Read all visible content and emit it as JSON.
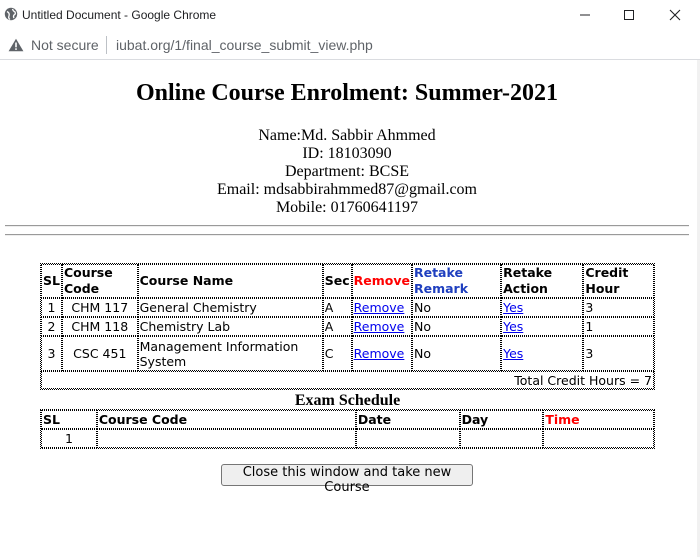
{
  "window": {
    "title": "Untitled Document - Google Chrome",
    "security_label": "Not secure",
    "url": "iubat.org/1/final_course_submit_view.php"
  },
  "page": {
    "heading": "Online Course Enrolment: Summer-2021",
    "student": {
      "name": "Name:Md. Sabbir Ahmmed",
      "id": "ID: 18103090",
      "department": "Department: BCSE",
      "email": "Email: mdsabbirahmmed87@gmail.com",
      "mobile": "Mobile: 01760641197"
    },
    "course_table": {
      "headers": [
        "SL",
        "Course Code",
        "Course Name",
        "Sec",
        "Remove",
        "Retake Remark",
        "Retake Action",
        "Credit Hour"
      ],
      "rows": [
        {
          "sl": "1",
          "code": "CHM 117",
          "name": "General Chemistry",
          "sec": "A",
          "remove": "Remove",
          "remark": "No",
          "action": "Yes",
          "credit": "3"
        },
        {
          "sl": "2",
          "code": "CHM 118",
          "name": "Chemistry Lab",
          "sec": "A",
          "remove": "Remove",
          "remark": "No",
          "action": "Yes",
          "credit": "1"
        },
        {
          "sl": "3",
          "code": "CSC 451",
          "name": "Management Information System",
          "sec": "C",
          "remove": "Remove",
          "remark": "No",
          "action": "Yes",
          "credit": "3"
        }
      ],
      "total": "Total Credit Hours = 7"
    },
    "exam_schedule": {
      "title": "Exam Schedule",
      "headers": [
        "SL",
        "Course Code",
        "Date",
        "Day",
        "Time"
      ],
      "rows": [
        {
          "sl": "1",
          "code": "",
          "date": "",
          "day": "",
          "time": ""
        }
      ]
    },
    "close_button": "Close this window and take new Course"
  },
  "colors": {
    "remove_header": "#ff0000",
    "retake_remark_header": "#1f3fbf",
    "time_header": "#ff0000",
    "link": "#0000ee"
  }
}
